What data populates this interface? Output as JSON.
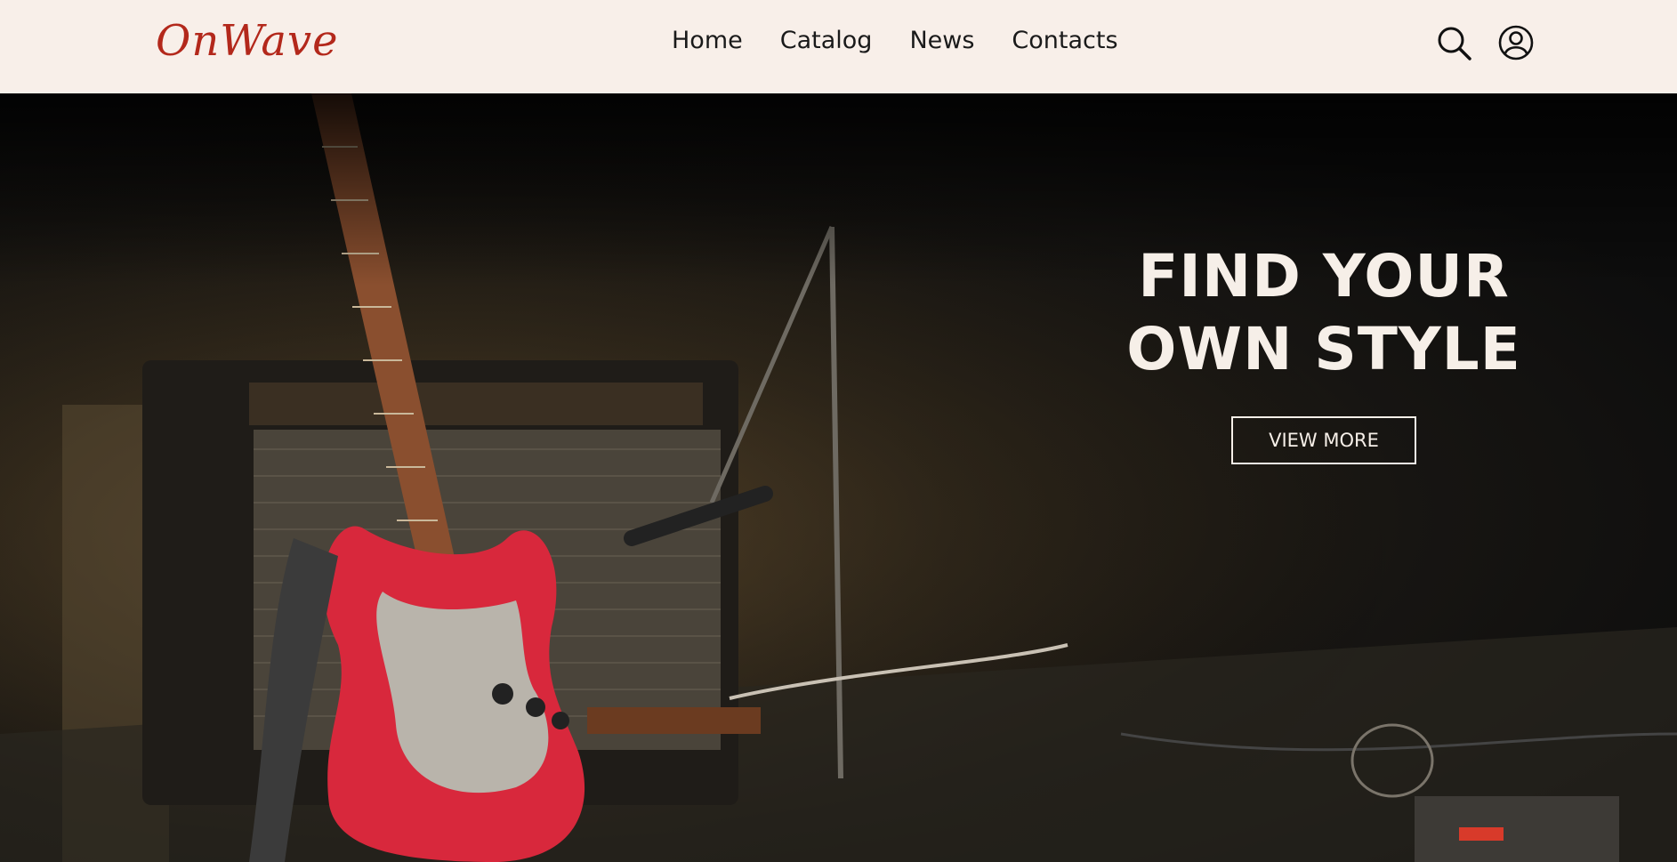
{
  "header": {
    "logo": "OnWave",
    "nav": [
      {
        "label": "Home"
      },
      {
        "label": "Catalog"
      },
      {
        "label": "News"
      },
      {
        "label": "Contacts"
      }
    ],
    "icons": [
      "search-icon",
      "user-account-icon"
    ]
  },
  "hero": {
    "title_line1": "FIND YOUR",
    "title_line2": "OWN STYLE",
    "button_label": "VIEW MORE",
    "image_subject": "red electric guitar leaning on amplifier with microphone stand"
  },
  "colors": {
    "header_bg": "#f8efe9",
    "brand": "#b3281b",
    "hero_text": "#f6efe8",
    "guitar_red": "#d8283c"
  }
}
